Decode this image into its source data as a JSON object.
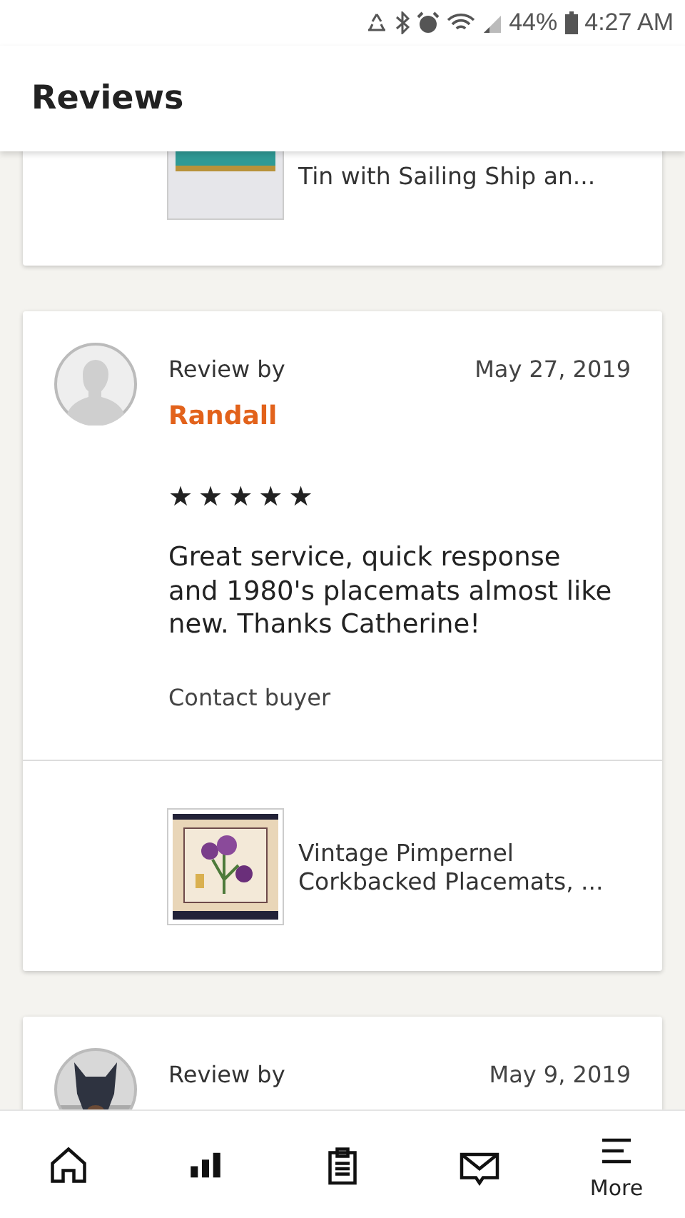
{
  "status_bar": {
    "battery": "44%",
    "time": "4:27 AM"
  },
  "header": {
    "title": "Reviews"
  },
  "reviews": [
    {
      "kind": "product_only",
      "product": {
        "title": "Tin with Sailing Ship an..."
      }
    },
    {
      "kind": "full",
      "label": "Review by",
      "reviewer": "Randall",
      "date": "May 27, 2019",
      "stars": 5,
      "text": "Great service, quick response and 1980's placemats almost like new.  Thanks Catherine!",
      "action": "Contact buyer",
      "product": {
        "title": "Vintage Pimpernel Corkbacked Placemats, ..."
      }
    },
    {
      "kind": "header_only",
      "label": "Review by",
      "date": "May 9, 2019"
    }
  ],
  "nav": [
    {
      "kind": "home"
    },
    {
      "kind": "stats"
    },
    {
      "kind": "orders"
    },
    {
      "kind": "messages"
    },
    {
      "kind": "menu",
      "label": "More"
    }
  ]
}
